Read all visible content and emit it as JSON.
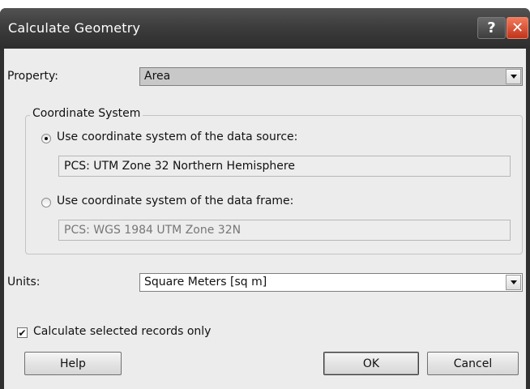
{
  "window": {
    "title": "Calculate Geometry",
    "help_glyph": "?",
    "close_glyph": "✕"
  },
  "property": {
    "label": "Property:",
    "value": "Area"
  },
  "coordinate_system": {
    "legend": "Coordinate System",
    "source_option": {
      "label": "Use coordinate system of the data source:",
      "selected": true,
      "value": "PCS: UTM Zone 32 Northern Hemisphere"
    },
    "frame_option": {
      "label": "Use coordinate system of the data frame:",
      "selected": false,
      "value": "PCS: WGS 1984 UTM Zone 32N"
    }
  },
  "units": {
    "label": "Units:",
    "value": "Square Meters [sq m]"
  },
  "selected_only": {
    "label": "Calculate selected records only",
    "checked": true,
    "check_glyph": "✔"
  },
  "buttons": {
    "help": "Help",
    "ok": "OK",
    "cancel": "Cancel"
  }
}
